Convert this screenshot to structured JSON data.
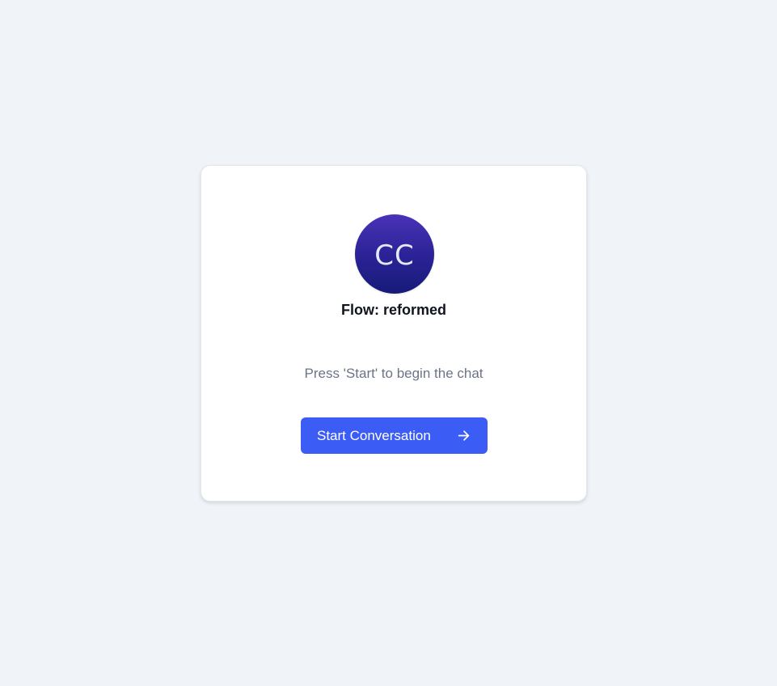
{
  "avatar": {
    "initials": "CC"
  },
  "flow": {
    "title": "Flow: reformed"
  },
  "instruction": "Press 'Start' to begin the chat",
  "start_button": {
    "label": "Start Conversation",
    "icon": "arrow-right-icon"
  },
  "colors": {
    "background": "#f0f4f8",
    "card": "#ffffff",
    "button": "#3c5cf6",
    "avatar_gradient_top": "#4a32b7",
    "avatar_gradient_bottom": "#151a78",
    "title_text": "#10141f",
    "muted_text": "#6b7486"
  }
}
